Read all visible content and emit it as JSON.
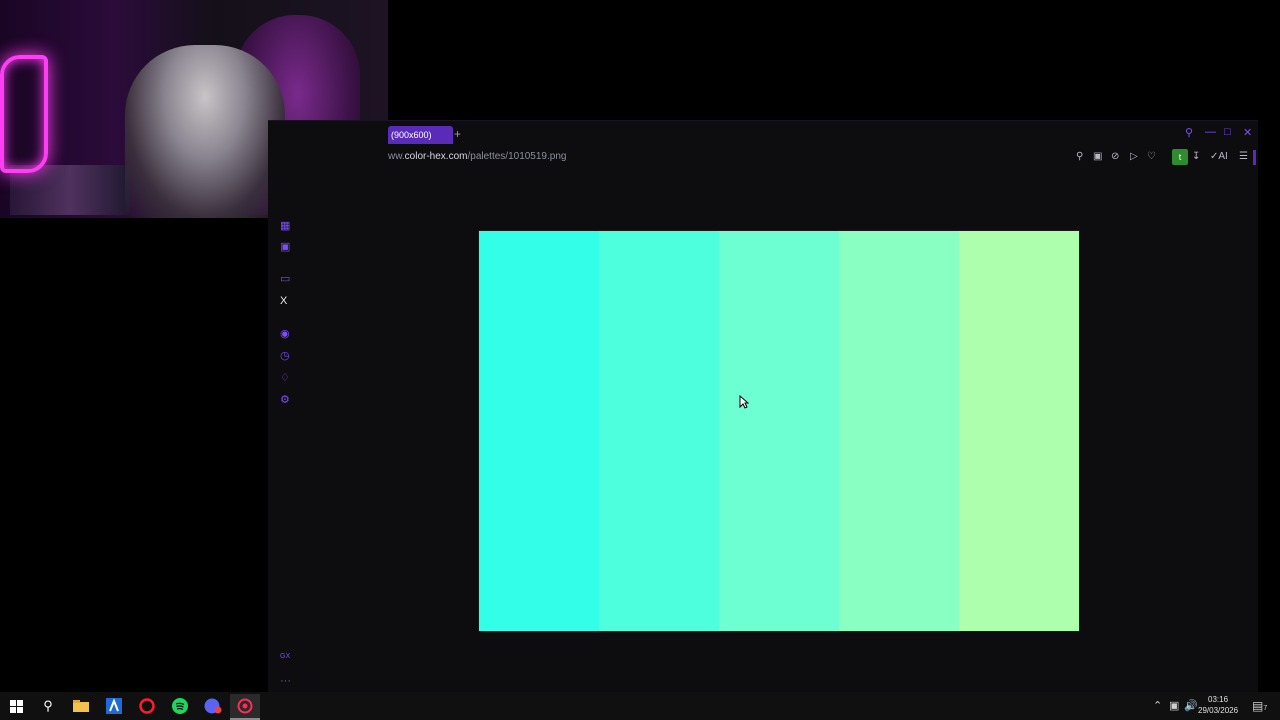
{
  "tab": {
    "label": "(900x600)",
    "new_tab": "+"
  },
  "address": {
    "url_prefix": "ww.",
    "url_host": "color-hex.com",
    "url_path": "/palettes/1010519.png"
  },
  "toolbar": {
    "badge": "t",
    "ai_label": "AI"
  },
  "sidebar": {
    "x_label": "X",
    "gx_label": "GX",
    "more_label": "···"
  },
  "palette": {
    "swatches": [
      "#33ffe8",
      "#4dffdc",
      "#6dffd2",
      "#8affc2",
      "#adffad"
    ]
  },
  "clock": {
    "time": "03:16",
    "date": "29/03/2026"
  },
  "notifications": {
    "count": "7"
  }
}
